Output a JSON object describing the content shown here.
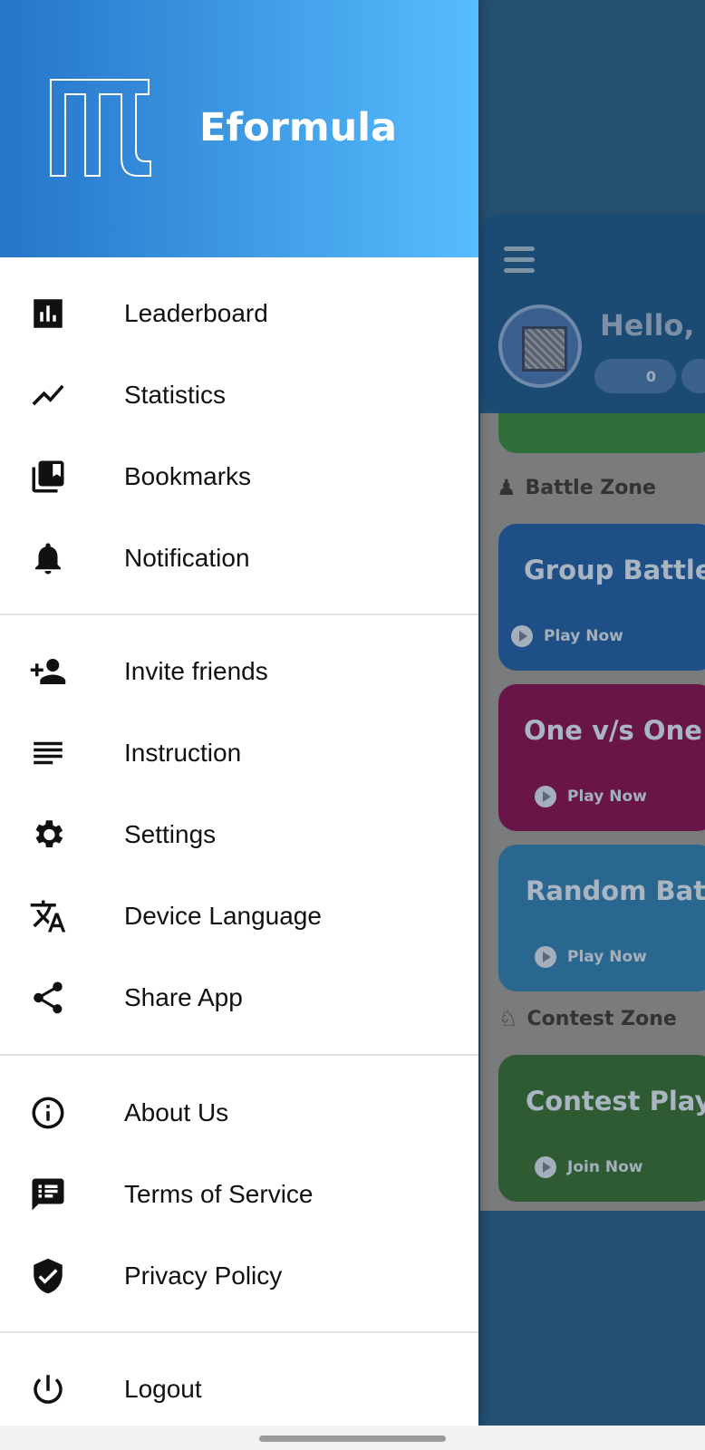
{
  "drawer": {
    "app_name": "Eformula",
    "groups": [
      [
        {
          "label": "Leaderboard",
          "icon": "leaderboard-icon"
        },
        {
          "label": "Statistics",
          "icon": "statistics-icon"
        },
        {
          "label": "Bookmarks",
          "icon": "bookmarks-icon"
        },
        {
          "label": "Notification",
          "icon": "bell-icon"
        }
      ],
      [
        {
          "label": "Invite friends",
          "icon": "add-person-icon"
        },
        {
          "label": "Instruction",
          "icon": "lines-icon"
        },
        {
          "label": "Settings",
          "icon": "gear-icon"
        },
        {
          "label": "Device Language",
          "icon": "translate-icon"
        },
        {
          "label": "Share App",
          "icon": "share-icon"
        }
      ],
      [
        {
          "label": "About Us",
          "icon": "info-icon"
        },
        {
          "label": "Terms of Service",
          "icon": "terms-icon"
        },
        {
          "label": "Privacy Policy",
          "icon": "shield-check-icon"
        }
      ],
      [
        {
          "label": "Logout",
          "icon": "power-icon"
        }
      ]
    ]
  },
  "background": {
    "greeting": "Hello, t",
    "coins": "0",
    "battle_zone": "Battle Zone",
    "contest_zone": "Contest Zone",
    "cards": [
      {
        "title": "Group Battle",
        "action": "Play Now",
        "color": "#1e4f86"
      },
      {
        "title": "One v/s One B",
        "action": "Play Now",
        "color": "#6a1547"
      },
      {
        "title": "Random Battl",
        "action": "Play Now",
        "color": "#2a6790"
      },
      {
        "title": "Contest Play",
        "action": "Join Now",
        "color": "#2f5b33"
      }
    ]
  }
}
